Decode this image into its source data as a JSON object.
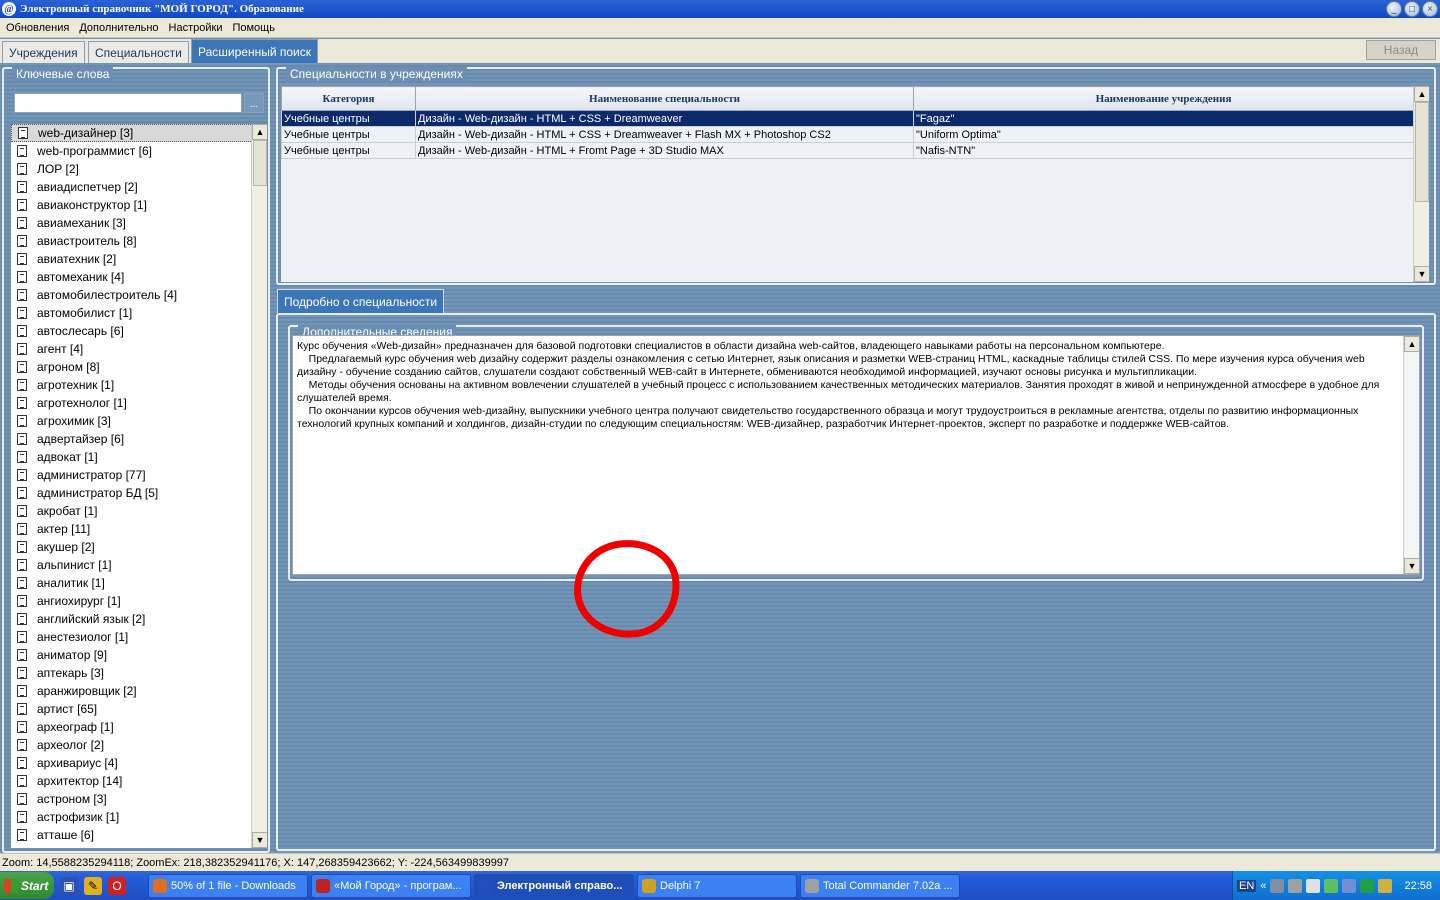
{
  "window": {
    "title": "Электронный справочник \"МОЙ ГОРОД\". Образование",
    "buttons": {
      "minimize": "_",
      "maximize": "□",
      "close": "×"
    }
  },
  "menu": [
    "Обновления",
    "Дополнительно",
    "Настройки",
    "Помощь"
  ],
  "tabs": [
    {
      "label": "Учреждения",
      "active": false
    },
    {
      "label": "Специальности",
      "active": false
    },
    {
      "label": "Расширенный поиск",
      "active": true
    }
  ],
  "back_button": "Назад",
  "keywords_panel": {
    "title": "Ключевые слова",
    "search_value": "",
    "search_button": "...",
    "items": [
      "web-дизайнер [3]",
      "web-программист [6]",
      "ЛОР [2]",
      "авиадиспетчер [2]",
      "авиаконструктор [1]",
      "авиамеханик [3]",
      "авиастроитель [8]",
      "авиатехник [2]",
      "автомеханик [4]",
      "автомобилестроитель [4]",
      "автомобилист [1]",
      "автослесарь [6]",
      "агент [4]",
      "агроном [8]",
      "агротехник [1]",
      "агротехнолог [1]",
      "агрохимик [3]",
      "адвертайзер [6]",
      "адвокат [1]",
      "администратор [77]",
      "администратор БД [5]",
      "акробат [1]",
      "актер [11]",
      "акушер [2]",
      "альпинист [1]",
      "аналитик [1]",
      "ангиохирург [1]",
      "английский язык [2]",
      "анестезиолог [1]",
      "аниматор [9]",
      "аптекарь [3]",
      "аранжировщик [2]",
      "артист [65]",
      "археограф [1]",
      "археолог [2]",
      "архивариус [4]",
      "архитектор [14]",
      "астроном [3]",
      "астрофизик [1]",
      "атташе [6]"
    ],
    "selected_index": 0
  },
  "specialties_panel": {
    "title": "Специальности в учреждениях",
    "columns": [
      "Категория",
      "Наименование специальности",
      "Наименование учреждения"
    ],
    "rows": [
      [
        "Учебные центры",
        "Дизайн - Web-дизайн - HTML + CSS + Dreamweaver",
        "\"Fagaz\""
      ],
      [
        "Учебные центры",
        "Дизайн - Web-дизайн - HTML + CSS + Dreamweaver + Flash MX + Photoshop CS2",
        "\"Uniform Optima\""
      ],
      [
        "Учебные центры",
        "Дизайн - Web-дизайн - HTML + Fromt Page + 3D Studio MAX",
        "\"Nafis-NTN\""
      ]
    ],
    "selected_row": 0
  },
  "details": {
    "tab_label": "Подробно о специальности",
    "group_title": "Дополнительные сведения",
    "paragraphs": [
      "Курс обучения «Web-дизайн» предназначен для базовой подготовки специалистов в области дизайна web-сайтов, владеющего навыками работы на персональном компьютере.",
      "    Предлагаемый курс обучения web дизайну содержит разделы ознакомления с сетью Интернет, язык описания и разметки WEB-страниц HTML, каскадные таблицы стилей CSS. По мере изучения курса обучения web дизайну - обучение созданию сайтов, слушатели создают собственный WEB-сайт в Интернете, обмениваются необходимой информацией, изучают основы рисунка и мультипликации.",
      "    Методы обучения основаны на активном вовлечении слушателей в учебный процесс с использованием качественных методических материалов. Занятия проходят в живой и непринужденной атмосфере в удобное для слушателей время.",
      "    По окончании курсов обучения web-дизайну, выпускники учебного центра получают свидетельство государственного образца и могут трудоустроиться в рекламные агентства, отделы по развитию информационных технологий крупных компаний и холдингов, дизайн-студии по следующим специальностям: WEB-дизайнер, разработчик Интернет-проектов, эксперт по разработке и поддержке WEB-сайтов."
    ]
  },
  "status_bar": "Zoom: 14,5588235294118; ZoomEx: 218,382352941176; X: 147,268359423662; Y: -224,563499839997",
  "taskbar": {
    "start": "Start",
    "tasks": [
      {
        "label": "50% of 1 file - Downloads",
        "icon_color": "#e07020",
        "active": false
      },
      {
        "label": "«Мой Город» - програм...",
        "icon_color": "#c02020",
        "active": false
      },
      {
        "label": "Электронный справо...",
        "icon_color": "#2050c0",
        "active": true
      },
      {
        "label": "Delphi 7",
        "icon_color": "#d0a020",
        "active": false
      },
      {
        "label": "Total Commander 7.02a ...",
        "icon_color": "#a0a0a0",
        "active": false
      }
    ],
    "tray_lang": "EN",
    "tray_chevron": "«",
    "clock": "22:58"
  },
  "colors": {
    "accent": "#3d76b6",
    "selection": "#0b2a6b",
    "annotation": "#f00000"
  }
}
